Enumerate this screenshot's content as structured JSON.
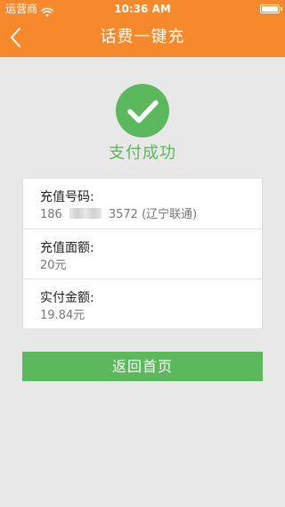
{
  "status_bar": {
    "carrier": "运营商",
    "time": "10:36 AM",
    "wifi_icon": "wifi-icon",
    "battery_icon": "battery-icon"
  },
  "nav": {
    "title": "话费一键充",
    "back_icon": "chevron-left-icon"
  },
  "result": {
    "icon": "check-circle-icon",
    "text": "支付成功"
  },
  "details": {
    "phone_label": "充值号码:",
    "phone_prefix": "186",
    "phone_suffix": "3572",
    "phone_carrier": "(辽宁联通)",
    "face_value_label": "充值面额:",
    "face_value": "20元",
    "paid_label": "实付金额:",
    "paid_value": "19.84元"
  },
  "actions": {
    "return_label": "返回首页"
  },
  "colors": {
    "header": "#f5892c",
    "success": "#5bb85c",
    "button": "#5cb85c",
    "background": "#e8e8e8"
  }
}
